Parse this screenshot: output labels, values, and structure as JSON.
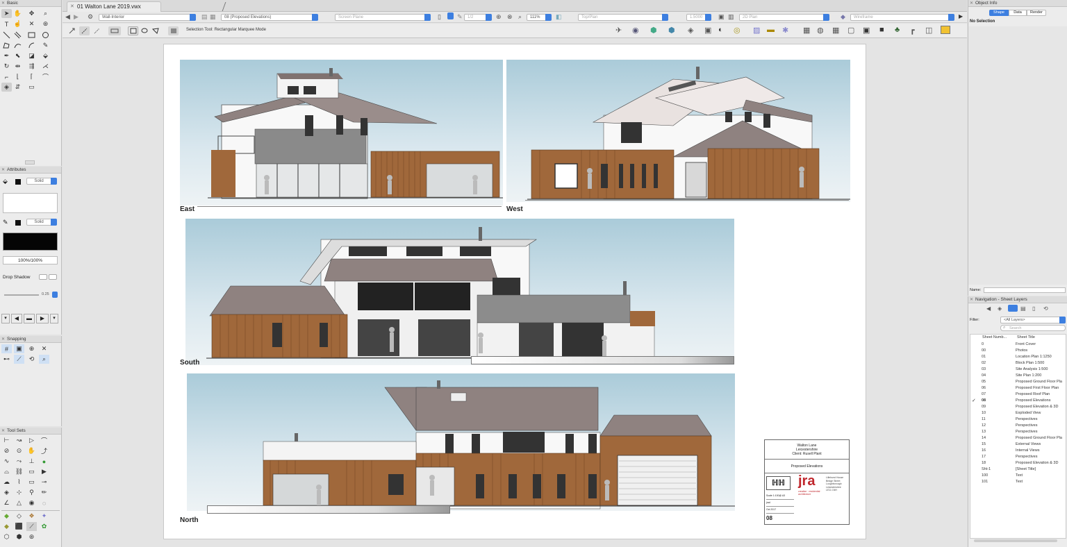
{
  "document": {
    "tab_title": "01 Walton Lane 2019.vwx",
    "class_value": "Wall-Interior",
    "layer_value": "08 (Proposed Elevations)",
    "plane_value": "Screen Plane",
    "zoom": "111%",
    "view_value": "Top/Plan",
    "render_value": "2D Plan",
    "wire_value": "Wireframe",
    "tool_hint": "Selection Tool: Rectangular Marquee Mode",
    "scale_value": "1/2",
    "misc_value": "1.5000"
  },
  "basic_palette": {
    "title": "Basic"
  },
  "attributes": {
    "title": "Attributes",
    "fill_style": "Solid",
    "pen_style": "Solid",
    "opacity": "100%/100%",
    "drop_shadow": "Drop Shadow",
    "line_weight": "0.25"
  },
  "snapping": {
    "title": "Snapping"
  },
  "tool_sets": {
    "title": "Tool Sets"
  },
  "object_info": {
    "title": "Object Info",
    "tabs": [
      "Shape",
      "Data",
      "Render"
    ],
    "selection": "No Selection",
    "name_label": "Name:"
  },
  "navigation": {
    "title": "Navigation - Sheet Layers",
    "filter_label": "Filter:",
    "filter_value": "<All Layers>",
    "search_placeholder": "Search",
    "col_number": "Sheet Numb...",
    "col_title": "Sheet Title",
    "rows": [
      {
        "num": "0",
        "title": "Front Cover",
        "active": false
      },
      {
        "num": "00",
        "title": "Photos",
        "active": false
      },
      {
        "num": "01",
        "title": "Location Plan 1:1250",
        "active": false
      },
      {
        "num": "02",
        "title": "Block Plan 1:500",
        "active": false
      },
      {
        "num": "03",
        "title": "Site Analysis 1:500",
        "active": false
      },
      {
        "num": "04",
        "title": "Site Plan 1:200",
        "active": false
      },
      {
        "num": "05",
        "title": "Proposed Ground Floor Pla",
        "active": false
      },
      {
        "num": "06",
        "title": "Proposed First Floor Plan",
        "active": false
      },
      {
        "num": "07",
        "title": "Proposed Roof Plan",
        "active": false
      },
      {
        "num": "08",
        "title": "Proposed Elevations",
        "active": true
      },
      {
        "num": "09",
        "title": "Proposed Elevation & 3D",
        "active": false
      },
      {
        "num": "10",
        "title": "Exploded View",
        "active": false
      },
      {
        "num": "11",
        "title": "Perspectives",
        "active": false
      },
      {
        "num": "12",
        "title": "Perspectives",
        "active": false
      },
      {
        "num": "13",
        "title": "Perspectives",
        "active": false
      },
      {
        "num": "14",
        "title": "Proposed Ground Floor Pla",
        "active": false
      },
      {
        "num": "15",
        "title": "External Views",
        "active": false
      },
      {
        "num": "16",
        "title": "Internal Views",
        "active": false
      },
      {
        "num": "17",
        "title": "Perspectives",
        "active": false
      },
      {
        "num": "18",
        "title": "Proposed Elevation & 3D",
        "active": false
      },
      {
        "num": "Sht-1",
        "title": "[Sheet Title]",
        "active": false
      },
      {
        "num": "100",
        "title": "Text",
        "active": false
      },
      {
        "num": "101",
        "title": "Text",
        "active": false
      }
    ]
  },
  "elevations": {
    "east": "East",
    "west": "West",
    "south": "South",
    "north": "North"
  },
  "title_block": {
    "project": "Walton Lane",
    "location": "Leicestershire",
    "client": "Client: Rusell Plant",
    "drawing": "Proposed Elevations",
    "logo": "jra",
    "logo_sub": "creative · residential · architecture",
    "scale": "Scale 1:100@ A3",
    "drawn": "jrad",
    "date": "Oct 2017",
    "sheet_no": "08",
    "address": [
      "Lillehurst House",
      "Bridge Street",
      "Loughborough",
      "Leicestershire",
      "LE11 1NH"
    ]
  },
  "colors": {
    "accent": "#3d7fe0",
    "timber": "#a0683b",
    "roof": "#8f8280",
    "sky": "#c2d9e3"
  }
}
